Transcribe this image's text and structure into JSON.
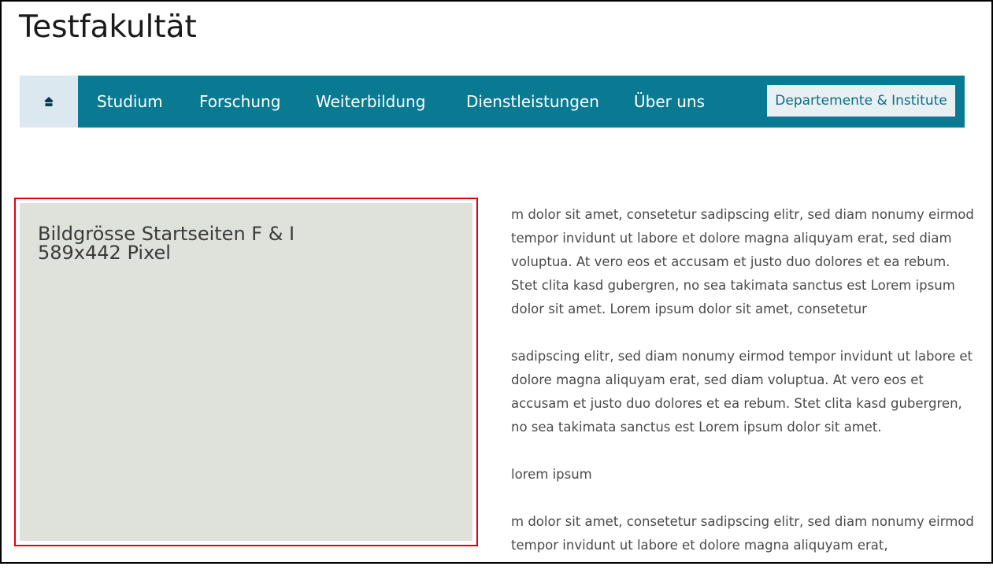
{
  "header": {
    "site_title": "Testfakultät"
  },
  "nav": {
    "home_icon": "home-icon",
    "items": [
      {
        "label": "Studium"
      },
      {
        "label": "Forschung"
      },
      {
        "label": "Weiterbildung"
      },
      {
        "label": "Dienstleistungen"
      },
      {
        "label": "Über uns"
      }
    ],
    "cta_label": "Departemente & Institute"
  },
  "image_placeholder": {
    "line1": "Bildgrösse Startseiten F & I",
    "line2": "589x442 Pixel"
  },
  "content": {
    "paragraphs": [
      "m dolor sit amet, consetetur sadipscing elitr, sed diam nonumy eirmod tempor invidunt ut labore et dolore magna aliquyam erat, sed diam voluptua. At vero eos et accusam et justo duo dolores et ea rebum. Stet clita kasd gubergren, no sea takimata sanctus est Lorem ipsum dolor sit amet. Lorem ipsum dolor sit amet, consetetur",
      "sadipscing elitr, sed diam nonumy eirmod tempor invidunt ut labore et dolore magna aliquyam erat, sed diam voluptua. At vero eos et accusam et justo duo dolores et ea rebum. Stet clita kasd gubergren, no sea takimata sanctus est Lorem ipsum dolor sit amet.",
      "lorem ipsum",
      "m dolor sit amet, consetetur sadipscing elitr, sed diam nonumy eirmod tempor invidunt ut labore et dolore magna aliquyam erat,"
    ]
  },
  "colors": {
    "nav_background": "#0a7a93",
    "home_background": "#dce8ef",
    "placeholder_background": "#dfe1db",
    "highlight_border": "#e0000f"
  }
}
